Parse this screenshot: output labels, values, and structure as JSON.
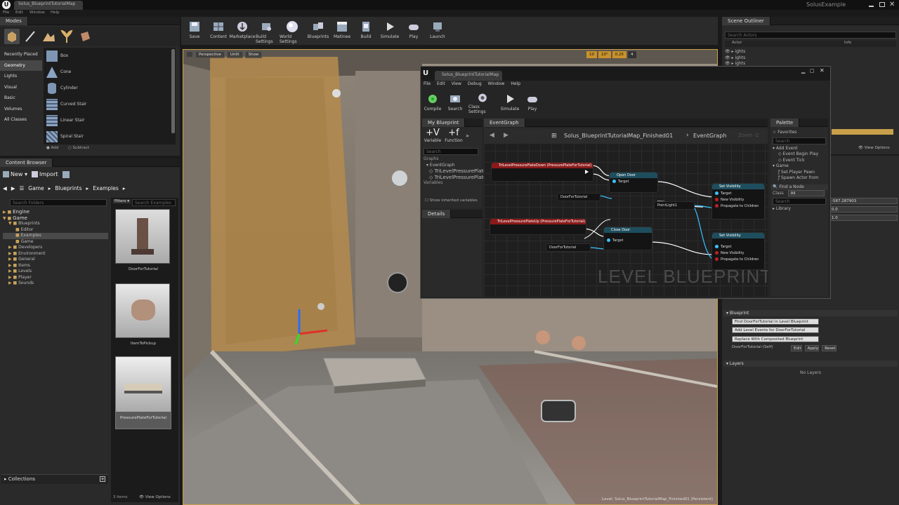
{
  "window": {
    "app_title": "Solus_BlueprintTutorialMap",
    "project_name": "SolusExample"
  },
  "modes": {
    "tab": "Modes",
    "categories": [
      "Recently Placed",
      "Geometry",
      "Lights",
      "Visual",
      "Basic",
      "Volumes",
      "All Classes"
    ],
    "items": [
      "Box",
      "Cone",
      "Cylinder",
      "Curved Stair",
      "Linear Stair",
      "Spiral Stair"
    ],
    "footer": [
      "Add",
      "Subtract"
    ]
  },
  "toolbar": {
    "buttons": [
      "Save",
      "Content",
      "Marketplace",
      "Build Settings",
      "World Settings",
      "Blueprints",
      "Matinee",
      "Build",
      "Simulate",
      "Play",
      "Launch"
    ]
  },
  "content_browser": {
    "tab": "Content Browser",
    "new_label": "New",
    "import_label": "Import",
    "path": [
      "Game",
      "Blueprints",
      "Examples"
    ],
    "search_placeholder": "Search Folders",
    "filters_label": "Filters",
    "assets_search_placeholder": "Search Examples",
    "tree": [
      "Engine",
      "Game",
      "Blueprints",
      "Editor",
      "Examples",
      "Game",
      "Developers",
      "Environment",
      "General",
      "Items",
      "Levels",
      "Player",
      "Sounds"
    ],
    "assets": [
      "DoorForTutorial",
      "ItemToPickup",
      "PressurePlateForTutorial"
    ],
    "collections_label": "Collections",
    "status": "3 items",
    "view_options": "View Options"
  },
  "viewport": {
    "perspective": "Perspective",
    "lit": "Unlit",
    "show": "Show",
    "snap_values": [
      "10",
      "10°",
      "0.25",
      "4"
    ],
    "level_caption": "Level: Solus_BlueprintTutorialMap_Finished01 (Persistent)"
  },
  "blueprint": {
    "tab": "Solus_BlueprintTutorialMap",
    "menu": [
      "File",
      "Edit",
      "View",
      "Debug",
      "Window",
      "Help"
    ],
    "toolbar": [
      "Compile",
      "Search",
      "Class Settings",
      "Simulate",
      "Play"
    ],
    "mybp_tab": "My Blueprint",
    "mybp_toolbar": [
      "Variable",
      "Function"
    ],
    "mybp_search": "Search",
    "mybp_section": "Graphs",
    "mybp_items": [
      "EventGraph",
      "TriLevelPressurePlate",
      "TriLevelPressurePlate"
    ],
    "mybp_section2": "Variables",
    "show_inherited": "Show inherited variables",
    "details_tab": "Details",
    "graph_tab": "EventGraph",
    "breadcrumb_map": "Solus_BlueprintTutorialMap_Finished01",
    "breadcrumb_graph": "EventGraph",
    "zoom": "Zoom -2",
    "watermark": "LEVEL BLUEPRINT",
    "nodes": {
      "n1_title": "TriLevelPressurePlateDown (PressurePlateForTutorial)",
      "n2_title": "TriLevelPressurePlateUp (PressurePlateForTutorial)",
      "open_door": "Open Door",
      "close_door": "Close Door",
      "set_vis": "Set Visibility",
      "set_vis2": "Set Visibility",
      "door_var": "DoorForTutorial",
      "door_var2": "DoorForTutorial",
      "point_light": "PointLight1",
      "target": "Target",
      "new_vis": "New Visibility",
      "propagate": "Propagate to Children"
    },
    "palette_tab": "Palette",
    "palette_section": "Favorites",
    "palette_search": "Search",
    "palette_items": [
      "Add Event",
      "Event Begin Play",
      "Event Tick",
      "Game",
      "Set Player Pawn",
      "Spawn Actor from"
    ],
    "find_node": "Find a Node",
    "class_label": "Class",
    "class_value": "All",
    "library": "Library"
  },
  "scene_outliner": {
    "tab": "Scene Outliner",
    "search_placeholder": "Search Actors",
    "col_actor": "Actor",
    "col_info": "Info",
    "items": [
      "ights",
      "ights",
      "ights"
    ],
    "view_options": "View Options"
  },
  "details": {
    "loc_values": [
      "-587.287903",
      "0.0",
      "1.0"
    ],
    "blueprint_section": "Blueprint",
    "bp_buttons": [
      "Find DoorForTutorial in Level Blueprint",
      "Add Level Events for DoorForTutorial",
      "Replace With Composited Blueprint"
    ],
    "bp_actions": [
      "DoorForTutorial (Self)",
      "Edit",
      "Apply",
      "Reset"
    ],
    "layers_section": "Layers",
    "no_layers": "No Layers"
  }
}
